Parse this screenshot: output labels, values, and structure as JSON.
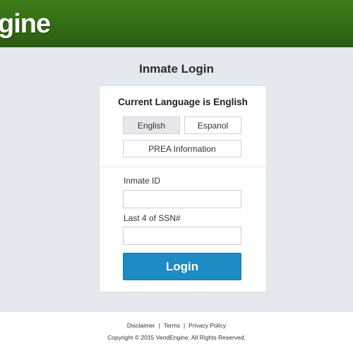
{
  "header": {
    "logo_text": "gine",
    "background_color": "#356f15"
  },
  "main": {
    "title": "Inmate Login"
  },
  "card": {
    "language_title": "Current Language is English",
    "buttons": {
      "english": "English",
      "espanol": "Espanol",
      "prea": "PREA Information"
    },
    "inmate_id": {
      "label": "Inmate ID",
      "value": "",
      "placeholder": ""
    },
    "ssn": {
      "label": "Last 4 of SSN#",
      "value": "",
      "placeholder": ""
    },
    "login_label": "Login",
    "login_color": "#1d8bc4"
  },
  "footer": {
    "links": {
      "disclaimer": "Disclaimer",
      "terms": "Terms",
      "privacy": "Privacy Policy"
    },
    "separator": "|",
    "copyright": "Copyright © 2015 VendEngine. All Rights Reserved."
  }
}
